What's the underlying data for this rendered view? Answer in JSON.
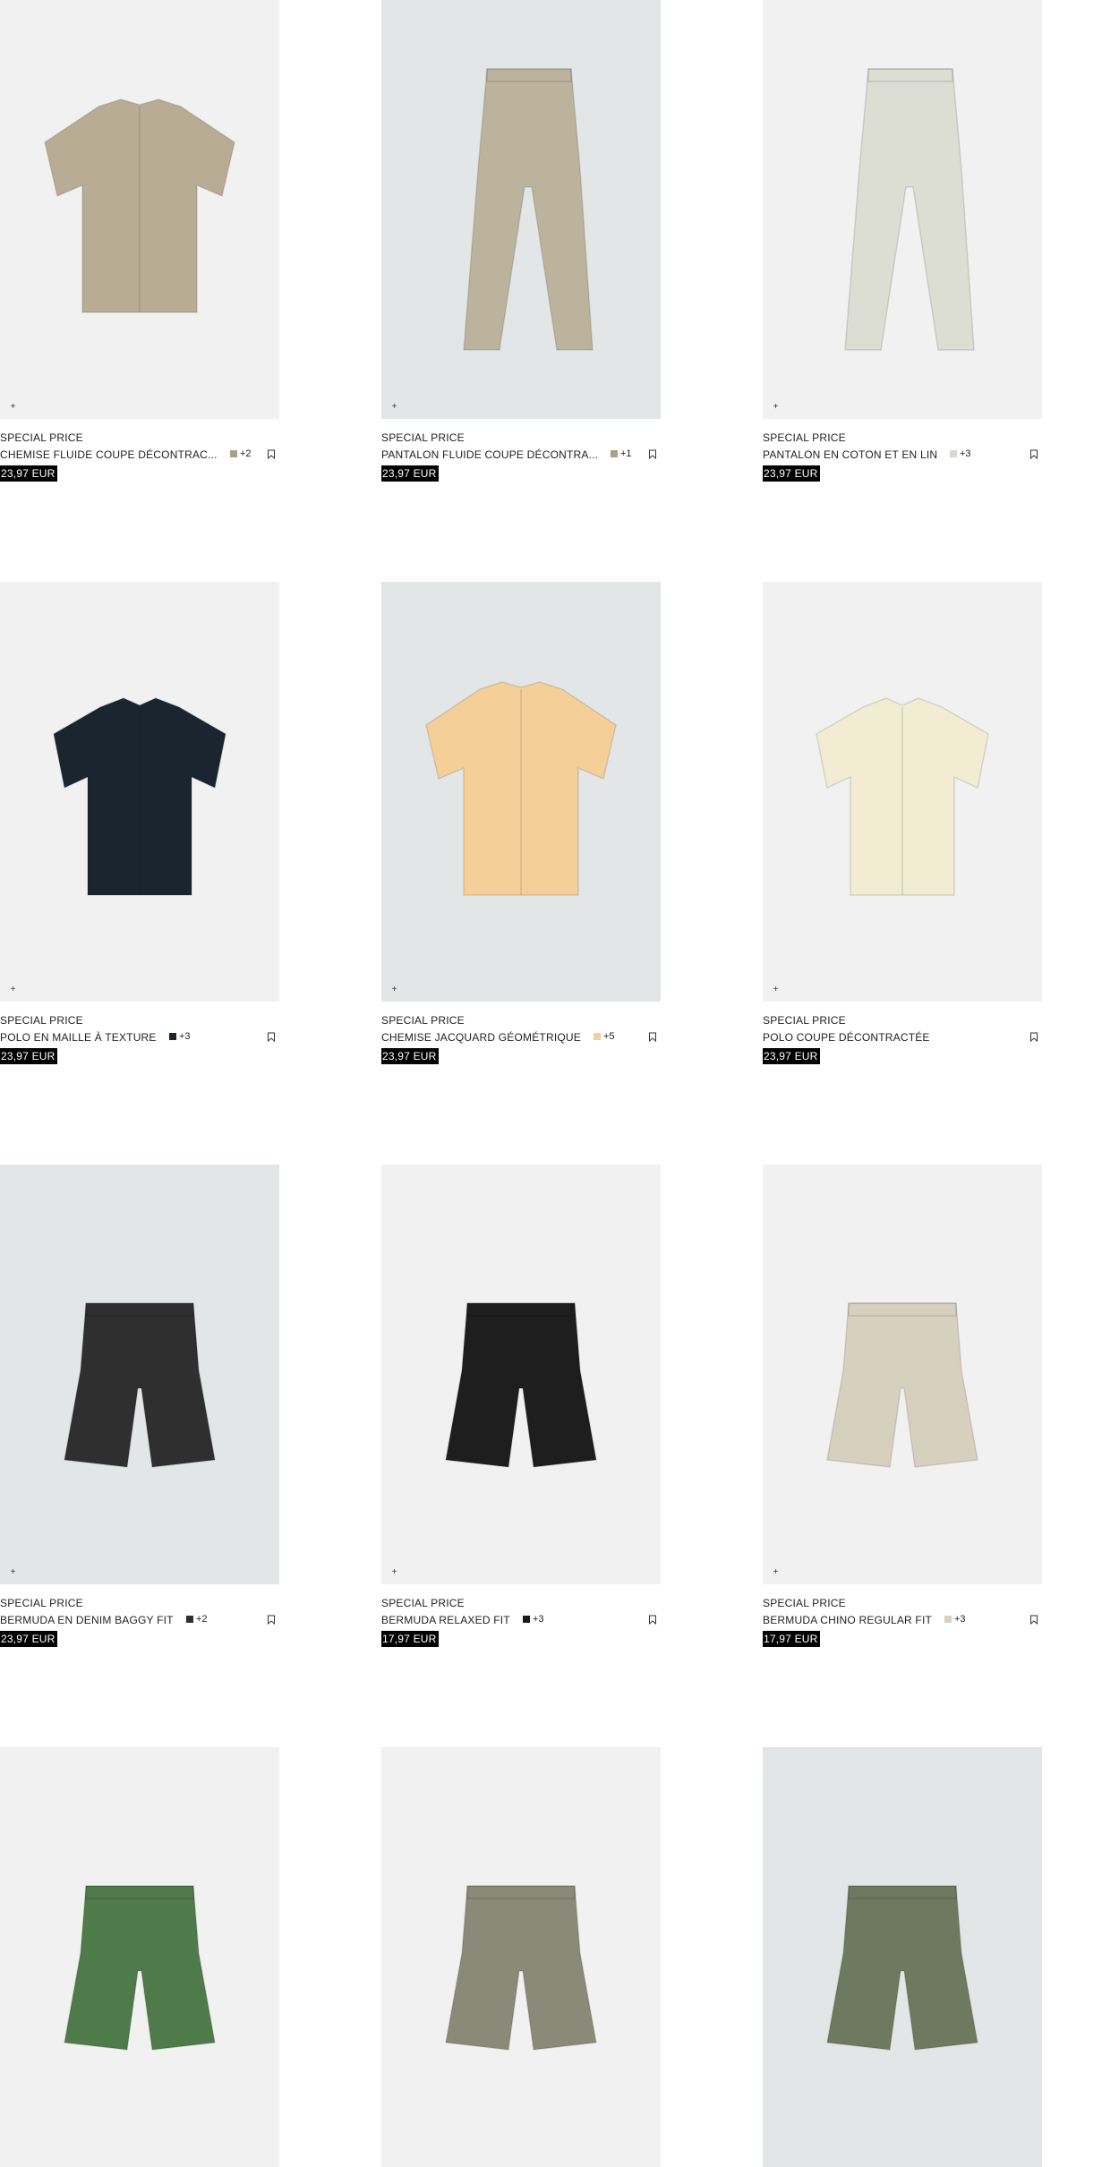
{
  "products": [
    {
      "badge": "SPECIAL PRICE",
      "name": "CHEMISE FLUIDE COUPE DÉCONTRAC...",
      "extra": "+2",
      "swatch": "#a8a08a",
      "price": "23,97 EUR",
      "bg": "light",
      "garment": "shirt",
      "color": "#b8ad94",
      "plus": "+"
    },
    {
      "badge": "SPECIAL PRICE",
      "name": "PANTALON FLUIDE COUPE DÉCONTRA...",
      "extra": "+1",
      "swatch": "#a8a08a",
      "price": "23,97 EUR",
      "bg": "blue",
      "garment": "pants",
      "color": "#bcb39c",
      "plus": "+"
    },
    {
      "badge": "SPECIAL PRICE",
      "name": "PANTALON EN COTON ET EN LIN",
      "extra": "+3",
      "swatch": "#d7d8cf",
      "price": "23,97 EUR",
      "bg": "light",
      "garment": "pants",
      "color": "#dcddd3",
      "plus": "+"
    },
    {
      "badge": "SPECIAL PRICE",
      "name": "POLO EN MAILLE À TEXTURE",
      "extra": "+3",
      "swatch": "#1b2530",
      "price": "23,97 EUR",
      "bg": "light",
      "garment": "polo",
      "color": "#1b2530",
      "plus": "+"
    },
    {
      "badge": "SPECIAL PRICE",
      "name": "CHEMISE JACQUARD GÉOMÉTRIQUE",
      "extra": "+5",
      "swatch": "#f2cf9b",
      "price": "23,97 EUR",
      "bg": "blue",
      "garment": "shirt",
      "color": "#f5cf98",
      "plus": "+"
    },
    {
      "badge": "SPECIAL PRICE",
      "name": "POLO COUPE DÉCONTRACTÉE",
      "extra": "",
      "swatch": "",
      "price": "23,97 EUR",
      "bg": "light",
      "garment": "polo",
      "color": "#f1ecd2",
      "plus": "+"
    },
    {
      "badge": "SPECIAL PRICE",
      "name": "BERMUDA EN DENIM BAGGY FIT",
      "extra": "+2",
      "swatch": "#2e2e2e",
      "price": "23,97 EUR",
      "bg": "blue",
      "garment": "shorts",
      "color": "#2f2f2f",
      "plus": "+"
    },
    {
      "badge": "SPECIAL PRICE",
      "name": "BERMUDA RELAXED FIT",
      "extra": "+3",
      "swatch": "#1a1a1a",
      "price": "17,97 EUR",
      "bg": "light",
      "garment": "shorts",
      "color": "#1e1e1e",
      "plus": "+"
    },
    {
      "badge": "SPECIAL PRICE",
      "name": "BERMUDA CHINO REGULAR FIT",
      "extra": "+3",
      "swatch": "#d7d1c1",
      "price": "17,97 EUR",
      "bg": "light",
      "garment": "shorts",
      "color": "#d8d0bf",
      "plus": "+"
    },
    {
      "badge": "",
      "name": "",
      "extra": "",
      "swatch": "",
      "price": "",
      "bg": "light",
      "garment": "shorts",
      "color": "#4f7a49",
      "plus": ""
    },
    {
      "badge": "",
      "name": "",
      "extra": "",
      "swatch": "",
      "price": "",
      "bg": "light",
      "garment": "shorts",
      "color": "#8a8a78",
      "plus": ""
    },
    {
      "badge": "",
      "name": "",
      "extra": "",
      "swatch": "",
      "price": "",
      "bg": "blue",
      "garment": "shorts",
      "color": "#6d7a60",
      "plus": ""
    }
  ]
}
